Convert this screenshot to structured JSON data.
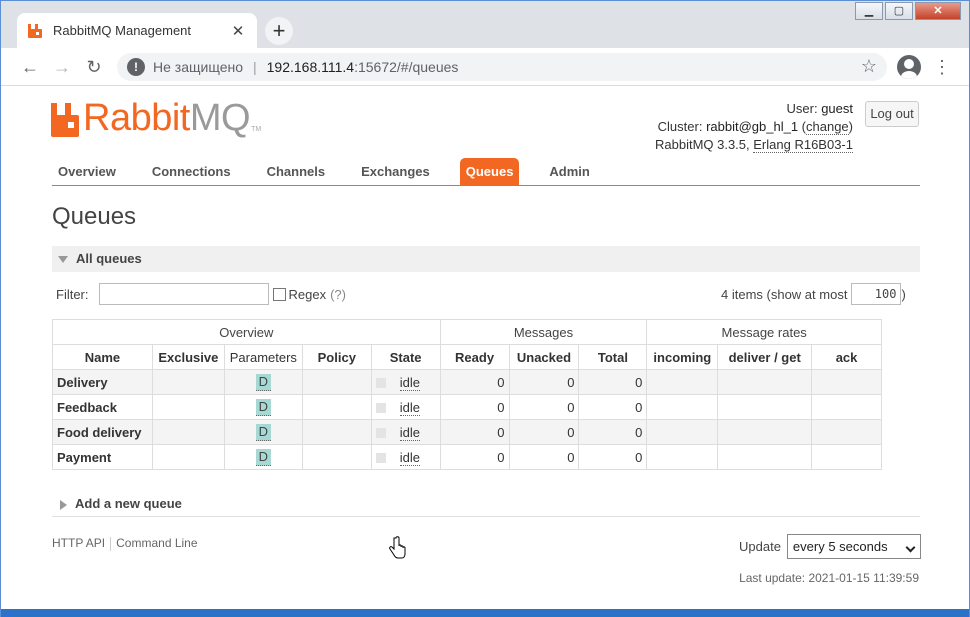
{
  "browser": {
    "tab_title": "RabbitMQ Management",
    "tab_close": "✕",
    "new_tab": "+",
    "back": "←",
    "forward": "→",
    "reload": "↻",
    "security_label": "Не защищено",
    "url_host": "192.168.111.4",
    "url_rest": ":15672/#/queues",
    "window_controls": [
      "▁",
      "▢",
      "✕"
    ]
  },
  "header": {
    "logo_rabbit": "Rabbit",
    "logo_mq": "MQ",
    "logo_tm": "TM",
    "user_label": "User:",
    "user": "guest",
    "cluster_label": "Cluster:",
    "cluster": "rabbit@gb_hl_1",
    "change": "change",
    "version": "RabbitMQ 3.3.5,",
    "erlang": "Erlang R16B03-1",
    "logout": "Log out"
  },
  "nav": {
    "items": [
      "Overview",
      "Connections",
      "Channels",
      "Exchanges",
      "Queues",
      "Admin"
    ],
    "active": "Queues"
  },
  "page_title": "Queues",
  "section_title": "All queues",
  "filter": {
    "label": "Filter:",
    "value": "",
    "regex_label": "Regex",
    "help": "(?)",
    "items_text": "4 items (show at most",
    "max_value": "100",
    "close_paren": ")"
  },
  "table": {
    "groups": [
      "Overview",
      "Messages",
      "Message rates"
    ],
    "columns": [
      "Name",
      "Exclusive",
      "Parameters",
      "Policy",
      "State",
      "Ready",
      "Unacked",
      "Total",
      "incoming",
      "deliver / get",
      "ack"
    ],
    "rows": [
      {
        "name": "Delivery",
        "param": "D",
        "state": "idle",
        "ready": "0",
        "unacked": "0",
        "total": "0"
      },
      {
        "name": "Feedback",
        "param": "D",
        "state": "idle",
        "ready": "0",
        "unacked": "0",
        "total": "0"
      },
      {
        "name": "Food delivery",
        "param": "D",
        "state": "idle",
        "ready": "0",
        "unacked": "0",
        "total": "0"
      },
      {
        "name": "Payment",
        "param": "D",
        "state": "idle",
        "ready": "0",
        "unacked": "0",
        "total": "0"
      }
    ]
  },
  "add_queue": "Add a new queue",
  "footer": {
    "http_api": "HTTP API",
    "command_line": "Command Line",
    "update_label": "Update",
    "update_value": "every 5 seconds",
    "last_update": "Last update: 2021-01-15 11:39:59"
  },
  "colors": {
    "brand": "#f26822",
    "param_badge": "#a6d9d4"
  }
}
